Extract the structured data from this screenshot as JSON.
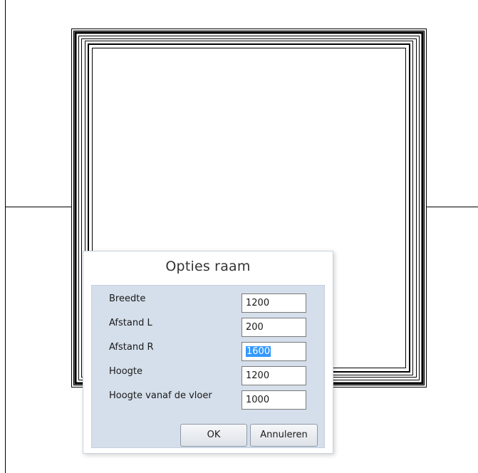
{
  "dialog": {
    "title": "Opties raam",
    "fields": [
      {
        "label": "Breedte",
        "value": "1200"
      },
      {
        "label": "Afstand L",
        "value": "200"
      },
      {
        "label": "Afstand R",
        "value": "1600",
        "selected": true
      },
      {
        "label": "Hoogte",
        "value": "1200"
      },
      {
        "label": "Hoogte vanaf de vloer",
        "value": "1000"
      }
    ],
    "ok_label": "OK",
    "cancel_label": "Annuleren"
  },
  "colors": {
    "panel": "#d5dfeb",
    "selection": "#3399ff",
    "line": "#000000"
  }
}
